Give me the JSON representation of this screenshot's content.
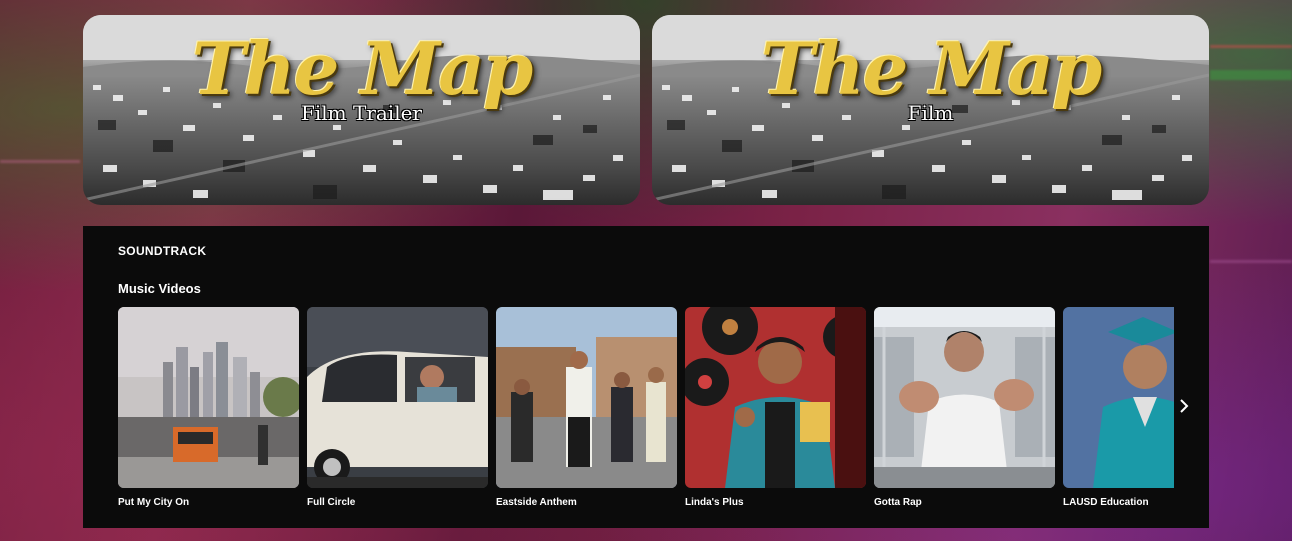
{
  "heroes": [
    {
      "logo": "The Map",
      "subtitle": "Film Trailer"
    },
    {
      "logo": "The Map",
      "subtitle": "Film"
    }
  ],
  "soundtrack": {
    "section_title": "SOUNDTRACK",
    "subsection_title": "Music Videos",
    "videos": [
      {
        "title": "Put My City On"
      },
      {
        "title": "Full Circle"
      },
      {
        "title": "Eastside Anthem"
      },
      {
        "title": "Linda's Plus"
      },
      {
        "title": "Gotta Rap"
      },
      {
        "title": "LAUSD Education"
      }
    ],
    "next_icon": "chevron-right-icon"
  },
  "colors": {
    "logo_gold": "#e8c542",
    "panel_bg": "#0b0b0b"
  }
}
